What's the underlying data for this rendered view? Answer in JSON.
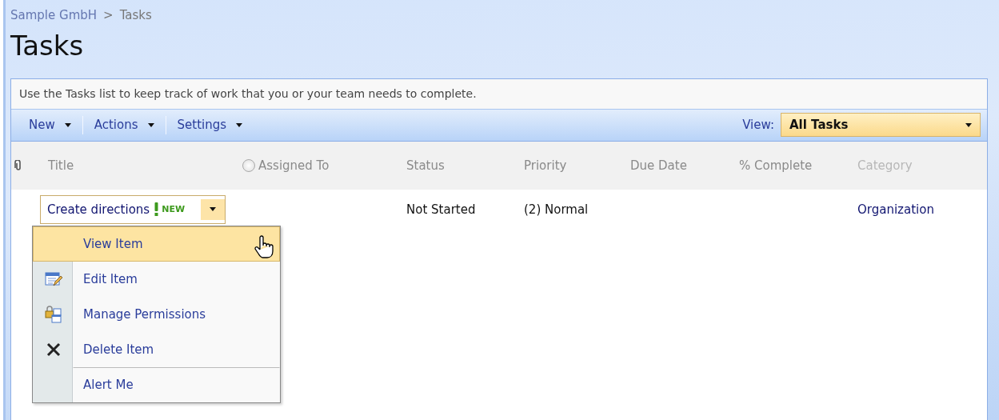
{
  "breadcrumb": [
    {
      "label": "Sample GmbH"
    },
    {
      "label": "Tasks"
    }
  ],
  "breadcrumb_separator": ">",
  "title": "Tasks",
  "description": "Use the Tasks list to keep track of work that you or your team needs to complete.",
  "toolbar": {
    "menus": [
      {
        "label": "New"
      },
      {
        "label": "Actions"
      },
      {
        "label": "Settings"
      }
    ],
    "view_label": "View:",
    "view_value": "All Tasks"
  },
  "columns": [
    {
      "label": "Title",
      "muted": false
    },
    {
      "label": "Assigned To",
      "muted": false
    },
    {
      "label": "Status",
      "muted": false
    },
    {
      "label": "Priority",
      "muted": false
    },
    {
      "label": "Due Date",
      "muted": false
    },
    {
      "label": "% Complete",
      "muted": false
    },
    {
      "label": "Category",
      "muted": true
    }
  ],
  "rows": [
    {
      "title": "Create directions",
      "new_badge": "NEW",
      "status": "Not Started",
      "priority": "(2) Normal",
      "category": "Organization"
    }
  ],
  "context_menu": {
    "items": [
      {
        "label": "View Item",
        "kind": "plain",
        "selected": true,
        "separator_above": false
      },
      {
        "label": "Edit Item",
        "kind": "edit",
        "selected": false,
        "separator_above": false
      },
      {
        "label": "Manage Permissions",
        "kind": "permissions",
        "selected": false,
        "separator_above": false
      },
      {
        "label": "Delete Item",
        "kind": "delete",
        "selected": false,
        "separator_above": false
      },
      {
        "label": "Alert Me",
        "kind": "plain",
        "selected": false,
        "separator_above": true
      }
    ]
  }
}
